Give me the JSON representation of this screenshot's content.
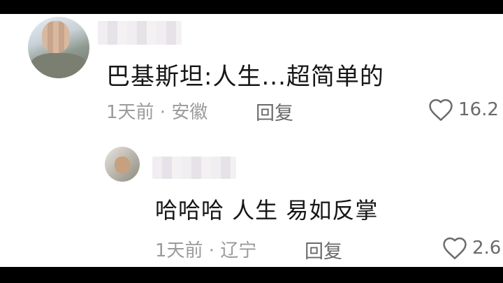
{
  "comment": {
    "text": "巴基斯坦:人生...超简单的",
    "meta": "1天前 · 安徽",
    "reply_label": "回复",
    "likes": "16.2"
  },
  "reply": {
    "text": "哈哈哈 人生 易如反掌",
    "meta": "1天前 · 辽宁",
    "reply_label": "回复",
    "likes": "2.6"
  }
}
